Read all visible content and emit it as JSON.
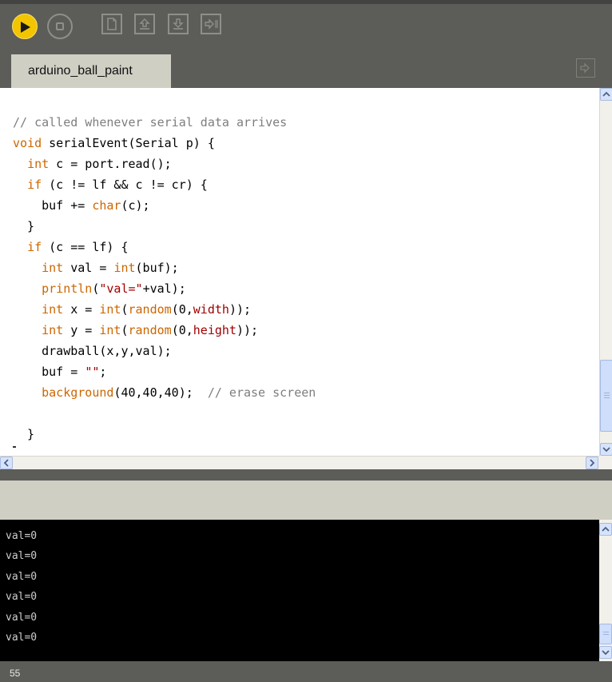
{
  "toolbar": {
    "buttons": [
      "run",
      "stop",
      "new",
      "open",
      "save",
      "export"
    ],
    "accent": "#f2c500"
  },
  "tabs": [
    {
      "label": "arduino_ball_paint"
    }
  ],
  "editor": {
    "lines": [
      [
        {
          "t": "// called whenever serial data arrives",
          "c": "cm"
        }
      ],
      [
        {
          "t": "void",
          "c": "kw"
        },
        {
          "t": " serialEvent(Serial p) {"
        }
      ],
      [
        {
          "t": "  "
        },
        {
          "t": "int",
          "c": "kw"
        },
        {
          "t": " c = port.read();"
        }
      ],
      [
        {
          "t": "  "
        },
        {
          "t": "if",
          "c": "kw"
        },
        {
          "t": " (c != lf && c != cr) {"
        }
      ],
      [
        {
          "t": "    buf += "
        },
        {
          "t": "char",
          "c": "kw"
        },
        {
          "t": "(c);"
        }
      ],
      [
        {
          "t": "  }"
        }
      ],
      [
        {
          "t": "  "
        },
        {
          "t": "if",
          "c": "kw"
        },
        {
          "t": " (c == lf) {"
        }
      ],
      [
        {
          "t": "    "
        },
        {
          "t": "int",
          "c": "kw"
        },
        {
          "t": " val = "
        },
        {
          "t": "int",
          "c": "kw"
        },
        {
          "t": "(buf);"
        }
      ],
      [
        {
          "t": "    "
        },
        {
          "t": "println",
          "c": "kw"
        },
        {
          "t": "("
        },
        {
          "t": "\"val=\"",
          "c": "st"
        },
        {
          "t": "+val);"
        }
      ],
      [
        {
          "t": "    "
        },
        {
          "t": "int",
          "c": "kw"
        },
        {
          "t": " x = "
        },
        {
          "t": "int",
          "c": "kw"
        },
        {
          "t": "("
        },
        {
          "t": "random",
          "c": "kw"
        },
        {
          "t": "(0,"
        },
        {
          "t": "width",
          "c": "st"
        },
        {
          "t": "));"
        }
      ],
      [
        {
          "t": "    "
        },
        {
          "t": "int",
          "c": "kw"
        },
        {
          "t": " y = "
        },
        {
          "t": "int",
          "c": "kw"
        },
        {
          "t": "("
        },
        {
          "t": "random",
          "c": "kw"
        },
        {
          "t": "(0,"
        },
        {
          "t": "height",
          "c": "st"
        },
        {
          "t": "));"
        }
      ],
      [
        {
          "t": "    drawball(x,y,val);"
        }
      ],
      [
        {
          "t": "    buf = "
        },
        {
          "t": "\"\"",
          "c": "st"
        },
        {
          "t": ";"
        }
      ],
      [
        {
          "t": "    "
        },
        {
          "t": "background",
          "c": "kw"
        },
        {
          "t": "(40,40,40);  "
        },
        {
          "t": "// erase screen",
          "c": "cm"
        }
      ],
      [
        {
          "t": ""
        }
      ],
      [
        {
          "t": "  }"
        }
      ]
    ]
  },
  "console": {
    "lines": [
      "val=0",
      "val=0",
      "val=0",
      "val=0",
      "val=0",
      "val=0"
    ]
  },
  "status": {
    "line_number": "55"
  }
}
